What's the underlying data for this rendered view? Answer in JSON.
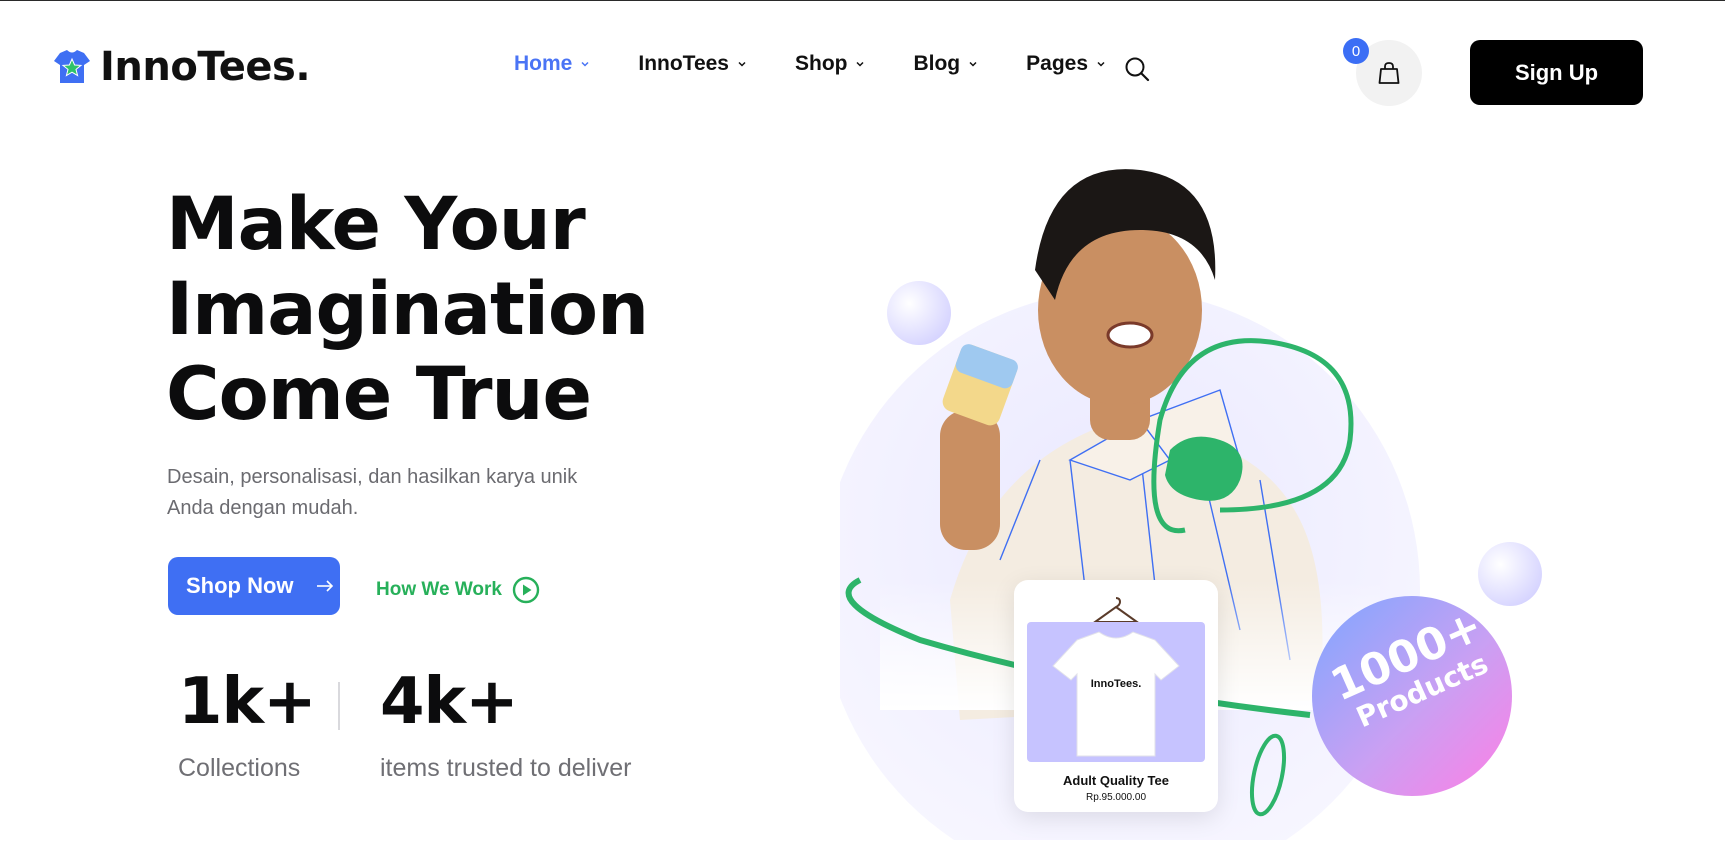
{
  "brand": {
    "name": "InnoTees.",
    "logo_icon": "tshirt-star-icon"
  },
  "nav": {
    "items": [
      {
        "label": "Home",
        "active": true
      },
      {
        "label": "InnoTees",
        "active": false
      },
      {
        "label": "Shop",
        "active": false
      },
      {
        "label": "Blog",
        "active": false
      },
      {
        "label": "Pages",
        "active": false
      }
    ],
    "search_icon": "search-icon"
  },
  "cart": {
    "count": "0",
    "icon": "shopping-bag-icon"
  },
  "signup_label": "Sign Up",
  "hero": {
    "title_lines": [
      "Make Your",
      "Imagination",
      "Come True"
    ],
    "description": "Desain, personalisasi, dan hasilkan karya unik Anda dengan mudah.",
    "shop_label": "Shop Now",
    "how_label": "How We Work"
  },
  "stats": [
    {
      "value": "1k+",
      "label": "Collections"
    },
    {
      "value": "4k+",
      "label": "items trusted to deliver"
    }
  ],
  "product": {
    "name": "Adult Quality Tee",
    "price": "Rp.95.000.00",
    "shirt_print": "InnoTees."
  },
  "badge": {
    "line1": "1000+",
    "line2": "Products"
  },
  "colors": {
    "primary": "#3f6ff3",
    "accent_green": "#27b05a",
    "dark": "#000000"
  }
}
